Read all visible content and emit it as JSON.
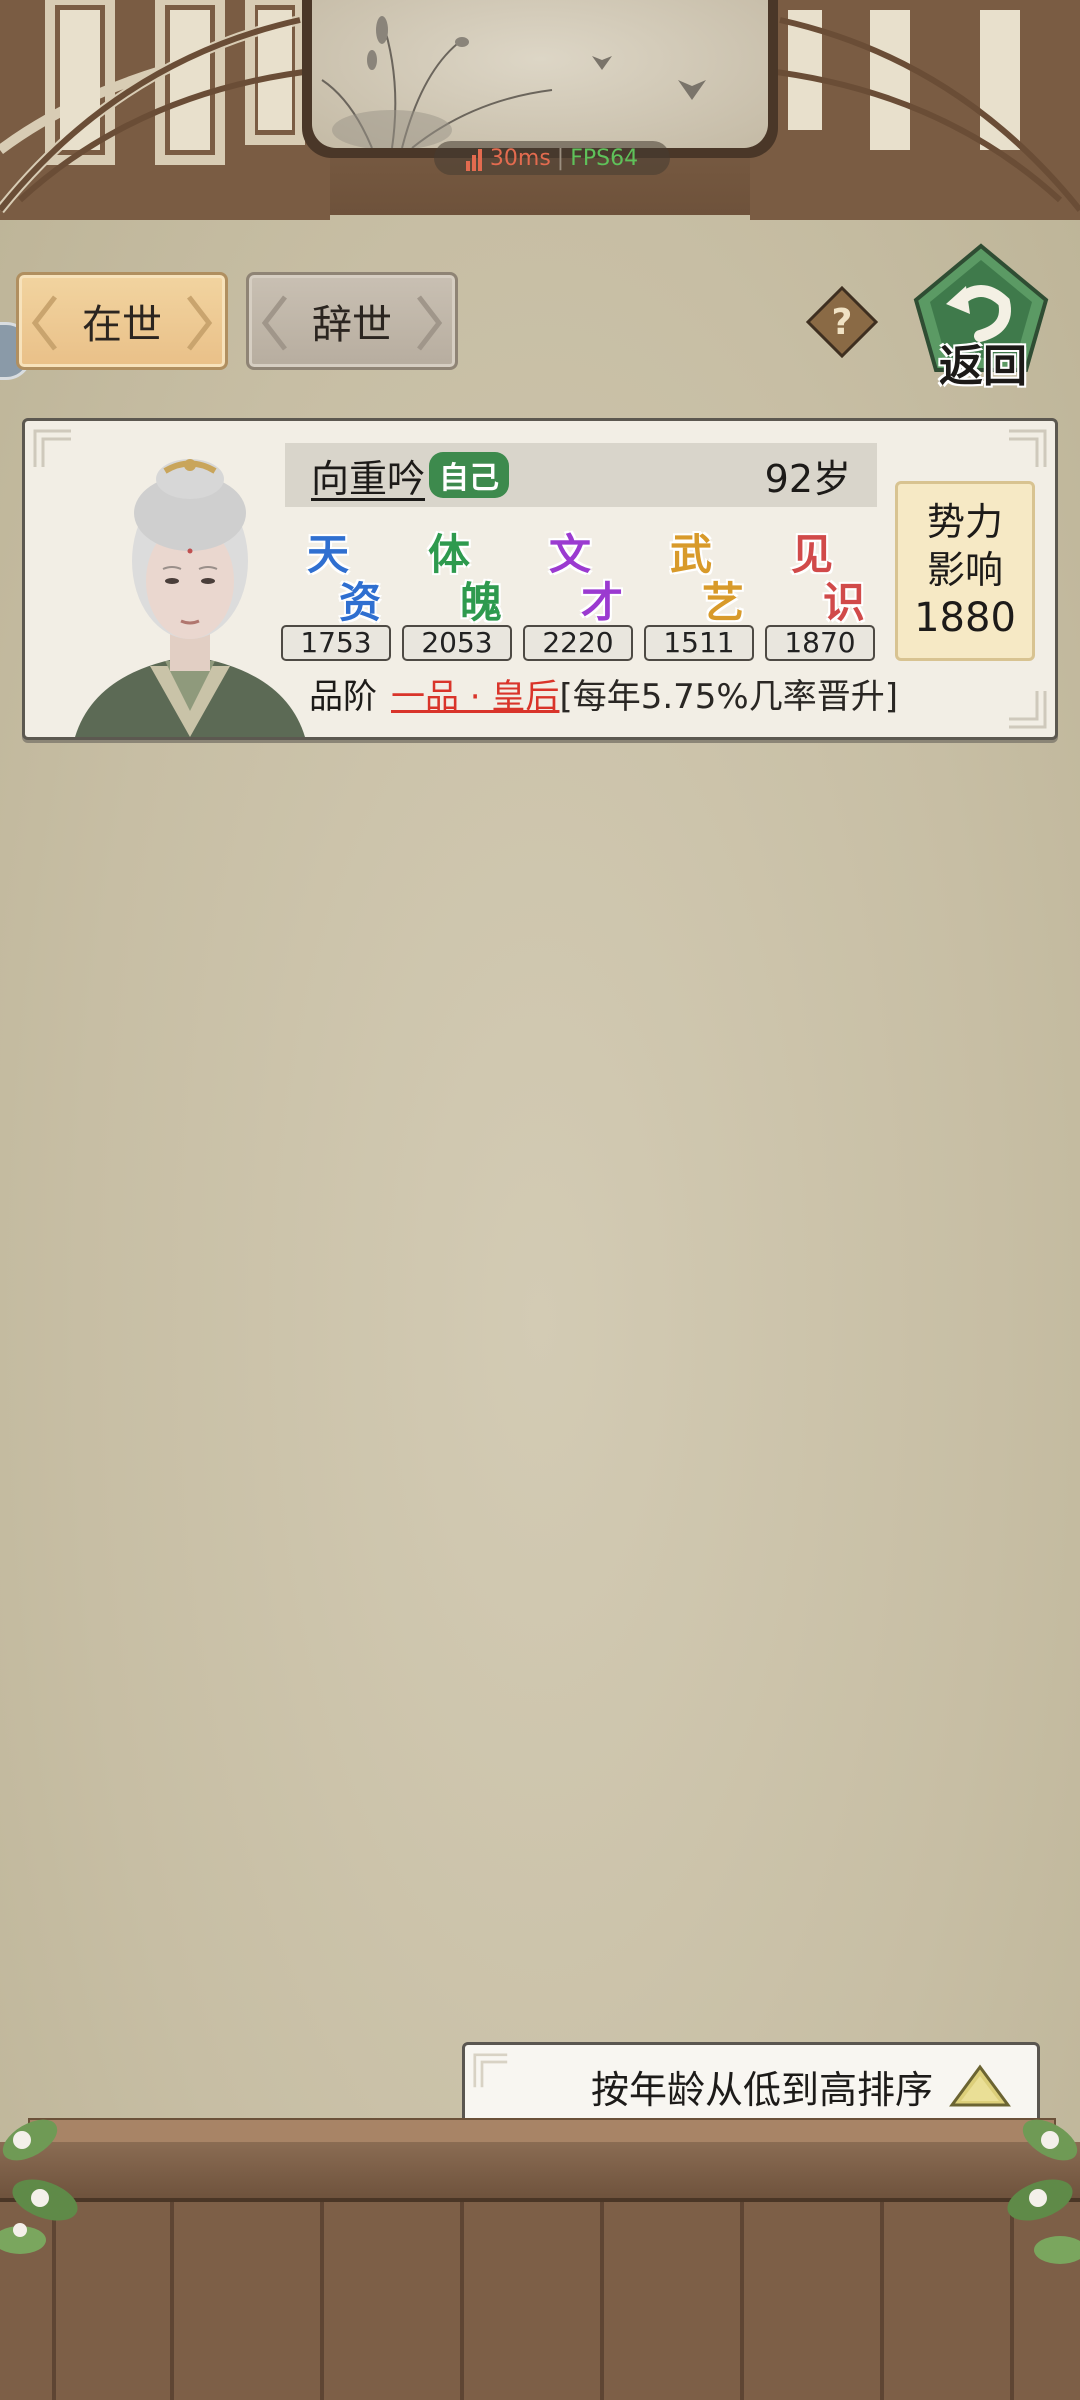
{
  "status_overlay": {
    "ping": "30ms",
    "separator": "|",
    "fps": "FPS64"
  },
  "tabs": [
    {
      "label": "在世",
      "active": true
    },
    {
      "label": "辞世",
      "active": false
    }
  ],
  "top_right": {
    "help_icon": "question-icon",
    "back_label": "返回"
  },
  "character": {
    "name": "向重吟",
    "tag": "自己",
    "age": "92岁",
    "attributes": [
      {
        "chars": [
          "天",
          "资"
        ],
        "value": "1753",
        "color": "#2f6fd0"
      },
      {
        "chars": [
          "体",
          "魄"
        ],
        "value": "2053",
        "color": "#2e9a4e"
      },
      {
        "chars": [
          "文",
          "才"
        ],
        "value": "2220",
        "color": "#9b3ad0"
      },
      {
        "chars": [
          "武",
          "艺"
        ],
        "value": "1511",
        "color": "#d89a2a"
      },
      {
        "chars": [
          "见",
          "识"
        ],
        "value": "1870",
        "color": "#d14a4a"
      }
    ],
    "rank_label": "品阶",
    "rank": "一品 · 皇后",
    "rank_rate": "[每年5.75%几率晋升]",
    "influence": {
      "line1": "势力",
      "line2": "影响",
      "value": "1880"
    }
  },
  "sort_button": {
    "label": "按年龄从低到高排序",
    "icon": "triangle-up-icon"
  },
  "colors": {
    "background": "#c7bea4",
    "active_tab": "#ecc58d",
    "inactive_tab": "#bdb3a5",
    "rank_red": "#d9342a"
  }
}
